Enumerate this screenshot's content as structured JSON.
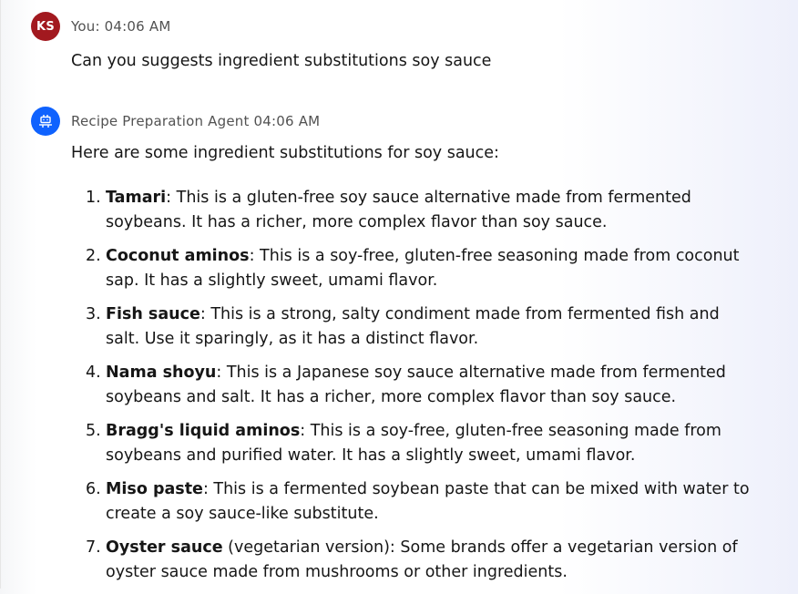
{
  "user_message": {
    "initials": "KS",
    "sender_label": "You: 04:06 AM",
    "text": "Can you suggests ingredient substitutions soy sauce"
  },
  "agent_message": {
    "icon": "robot-icon",
    "sender_label": "Recipe Preparation Agent 04:06 AM",
    "intro": "Here are some ingredient substitutions for soy sauce:",
    "items": [
      {
        "num": "1.",
        "name": "Tamari",
        "desc": ": This is a gluten-free soy sauce alternative made from fermented soybeans. It has a richer, more complex flavor than soy sauce."
      },
      {
        "num": "2.",
        "name": "Coconut aminos",
        "desc": ": This is a soy-free, gluten-free seasoning made from coconut sap. It has a slightly sweet, umami flavor."
      },
      {
        "num": "3.",
        "name": "Fish sauce",
        "desc": ": This is a strong, salty condiment made from fermented fish and salt. Use it sparingly, as it has a distinct flavor."
      },
      {
        "num": "4.",
        "name": "Nama shoyu",
        "desc": ": This is a Japanese soy sauce alternative made from fermented soybeans and salt. It has a richer, more complex flavor than soy sauce."
      },
      {
        "num": "5.",
        "name": "Bragg's liquid aminos",
        "desc": ": This is a soy-free, gluten-free seasoning made from soybeans and purified water. It has a slightly sweet, umami flavor."
      },
      {
        "num": "6.",
        "name": "Miso paste",
        "desc": ": This is a fermented soybean paste that can be mixed with water to create a soy sauce-like substitute."
      },
      {
        "num": "7.",
        "name": "Oyster sauce",
        "desc": " (vegetarian version): Some brands offer a vegetarian version of oyster sauce made from mushrooms or other ingredients."
      }
    ]
  },
  "colors": {
    "user_avatar": "#a2191f",
    "agent_avatar": "#0f62fe",
    "text": "#161616",
    "meta": "#525252"
  }
}
